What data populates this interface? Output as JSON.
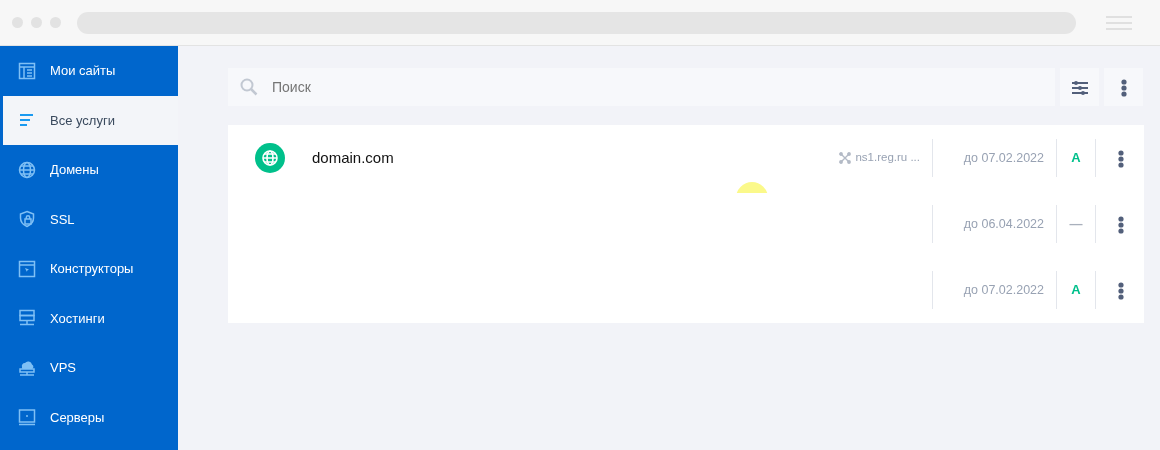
{
  "sidebar": {
    "items": [
      {
        "label": "Мои сайты",
        "selected": false
      },
      {
        "label": "Все услуги",
        "selected": true
      },
      {
        "label": "Домены",
        "selected": false
      },
      {
        "label": "SSL",
        "selected": false
      },
      {
        "label": "Конструкторы",
        "selected": false
      },
      {
        "label": "Хостинги",
        "selected": false
      },
      {
        "label": "VPS",
        "selected": false
      },
      {
        "label": "Серверы",
        "selected": false
      }
    ]
  },
  "search": {
    "placeholder": "Поиск"
  },
  "services": [
    {
      "name": "domain.com",
      "nameservers": "ns1.reg.ru ...",
      "expires": "до 07.02.2022",
      "status": "A",
      "color": "#00c08b"
    },
    {
      "expires": "до 06.04.2022",
      "status": "—",
      "color": "#a9b0bc"
    },
    {
      "expires": "до 07.02.2022",
      "status": "A",
      "color": "#00c08b"
    }
  ]
}
